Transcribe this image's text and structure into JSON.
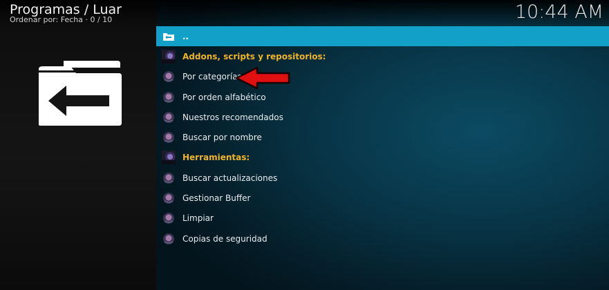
{
  "header": {
    "title": "Programas / Luar",
    "subtitle": "Ordenar por: Fecha  ·  0 / 10",
    "clock": "10:44 AM"
  },
  "colors": {
    "selected_bg": "#12a0c8",
    "category_text": "#f0b429",
    "arrow": "#e01010"
  },
  "list": {
    "items": [
      {
        "label": "..",
        "icon": "folder-up-icon",
        "type": "parent"
      },
      {
        "label": "Addons, scripts y repositorios:",
        "icon": "addon-thumbnail-icon",
        "type": "header"
      },
      {
        "label": "Por categorías",
        "icon": "addon-icon",
        "type": "item"
      },
      {
        "label": "Por orden alfabético",
        "icon": "addon-icon",
        "type": "item"
      },
      {
        "label": "Nuestros recomendados",
        "icon": "addon-icon",
        "type": "item"
      },
      {
        "label": "Buscar por nombre",
        "icon": "addon-icon",
        "type": "item"
      },
      {
        "label": "Herramientas:",
        "icon": "addon-thumbnail-icon",
        "type": "header"
      },
      {
        "label": "Buscar actualizaciones",
        "icon": "addon-icon",
        "type": "item"
      },
      {
        "label": "Gestionar Buffer",
        "icon": "addon-icon",
        "type": "item"
      },
      {
        "label": "Limpiar",
        "icon": "addon-icon",
        "type": "item"
      },
      {
        "label": "Copias de seguridad",
        "icon": "addon-icon",
        "type": "item"
      }
    ]
  }
}
